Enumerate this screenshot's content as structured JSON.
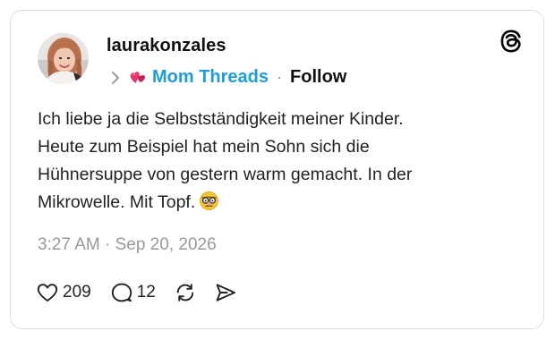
{
  "post": {
    "username": "laurakonzales",
    "community": {
      "name": "Mom Threads",
      "icon": "pink-hearts-icon",
      "follow_label": "Follow",
      "separator": "·"
    },
    "text_lines": [
      "Ich liebe ja die Selbstständigkeit meiner Kinder.",
      "Heute zum Beispiel hat mein Sohn sich die",
      "Hühnersuppe von gestern warm gemacht. In der",
      "Mikrowelle. Mit Topf."
    ],
    "emoji": "disguised-face-emoji",
    "timestamp": "3:27 AM · Sep 20, 2026",
    "actions": {
      "likes": "209",
      "replies": "12"
    }
  },
  "brand": {
    "logo": "threads-logo-icon"
  },
  "colors": {
    "community_link": "#1f9be0",
    "heart_pink": "#e8356b",
    "text": "#111111",
    "muted": "#999999",
    "border": "#dcdcdc"
  }
}
